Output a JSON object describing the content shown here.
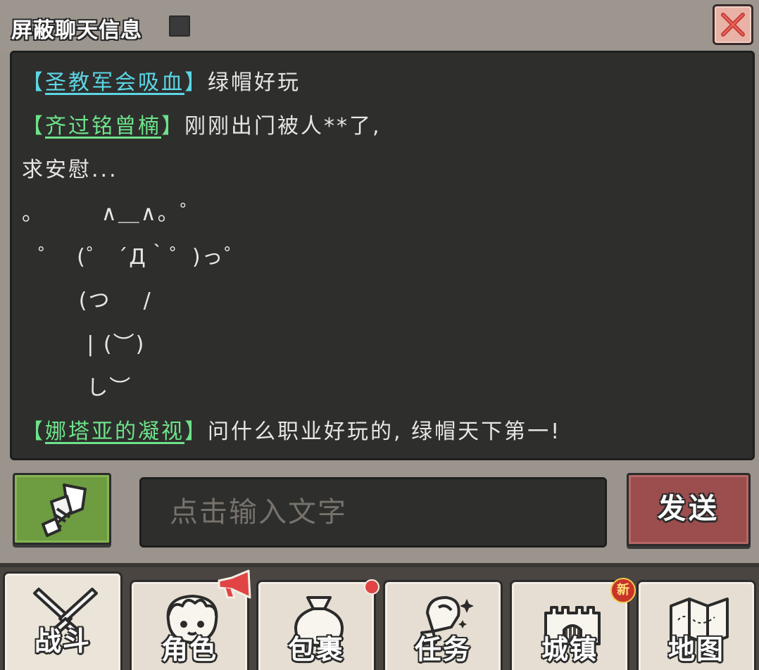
{
  "header": {
    "block_label": "屏蔽聊天信息",
    "close_icon": "close-x-icon"
  },
  "chat": {
    "messages": [
      {
        "sender": "圣教军会吸血",
        "color": "#5cd6e6",
        "text": "绿帽好玩"
      },
      {
        "sender": "齐过铭曾楠",
        "color": "#6ce38a",
        "text": "刚刚出门被人**了,"
      },
      {
        "sender": "",
        "text": "求安慰..."
      },
      {
        "sender": "",
        "text": "。       ∧＿∧。゜"
      },
      {
        "sender": "",
        "text": "  ゜  (゜ ´Д｀゜)っ゜"
      },
      {
        "sender": "",
        "text": "       (つ    /"
      },
      {
        "sender": "",
        "text": "        | (︶)"
      },
      {
        "sender": "",
        "text": "        し︶"
      },
      {
        "sender": "娜塔亚的凝视",
        "color": "#6ce38a",
        "text": "问什么职业好玩的, 绿帽天下第一!"
      }
    ]
  },
  "input": {
    "emote_icon": "gauntlet-icon",
    "placeholder": "点击输入文字",
    "send_label": "发送"
  },
  "nav": {
    "tabs": [
      {
        "label": "战斗",
        "icon": "crossed-swords-icon",
        "active": true
      },
      {
        "label": "角色",
        "icon": "character-face-icon",
        "badge": "megaphone"
      },
      {
        "label": "包裹",
        "icon": "money-bag-icon",
        "badge": "red-dot"
      },
      {
        "label": "任务",
        "icon": "quest-scroll-icon"
      },
      {
        "label": "城镇",
        "icon": "castle-icon",
        "badge": "新"
      },
      {
        "label": "地图",
        "icon": "map-icon"
      }
    ]
  }
}
